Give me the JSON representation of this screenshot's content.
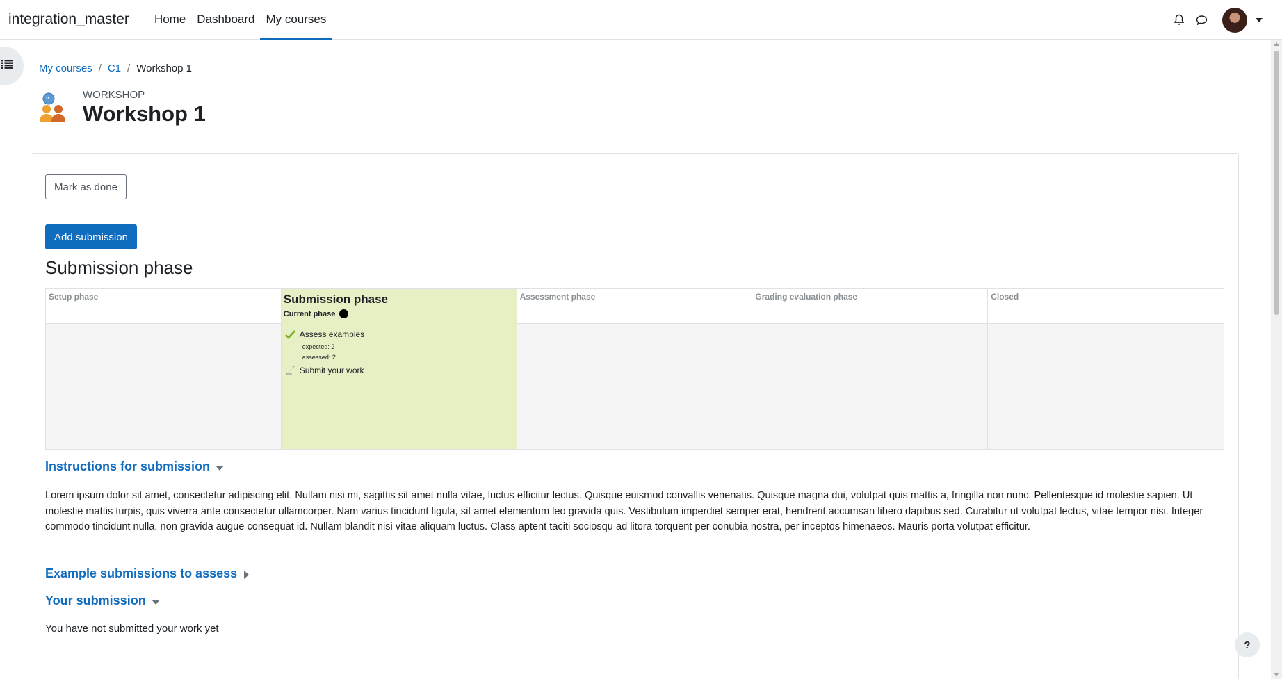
{
  "navbar": {
    "brand": "integration_master",
    "items": [
      {
        "label": "Home"
      },
      {
        "label": "Dashboard"
      },
      {
        "label": "My courses"
      }
    ]
  },
  "breadcrumb": {
    "items": [
      "My courses",
      "C1"
    ],
    "current": "Workshop 1"
  },
  "header": {
    "kind": "WORKSHOP",
    "title": "Workshop 1"
  },
  "actions": {
    "mark_done": "Mark as done",
    "add_submission": "Add submission"
  },
  "phase_heading": "Submission phase",
  "phases": [
    {
      "name": "Setup phase"
    },
    {
      "name": "Submission phase",
      "current_label": "Current phase"
    },
    {
      "name": "Assessment phase"
    },
    {
      "name": "Grading evaluation phase"
    },
    {
      "name": "Closed"
    }
  ],
  "tasks": [
    {
      "label": "Assess examples",
      "status": "done",
      "details": [
        "expected: 2",
        "assessed: 2"
      ]
    },
    {
      "label": "Submit your work",
      "status": "todo"
    }
  ],
  "sections": {
    "instructions": {
      "title": "Instructions for submission",
      "text": "Lorem ipsum dolor sit amet, consectetur adipiscing elit. Nullam nisi mi, sagittis sit amet nulla vitae, luctus efficitur lectus. Quisque euismod convallis venenatis. Quisque magna dui, volutpat quis mattis a, fringilla non nunc. Pellentesque id molestie sapien. Ut molestie mattis turpis, quis viverra ante consectetur ullamcorper. Nam varius tincidunt ligula, sit amet elementum leo gravida quis. Vestibulum imperdiet semper erat, hendrerit accumsan libero dapibus sed. Curabitur ut volutpat lectus, vitae tempor nisi. Integer commodo tincidunt nulla, non gravida augue consequat id. Nullam blandit nisi vitae aliquam luctus. Class aptent taciti sociosqu ad litora torquent per conubia nostra, per inceptos himenaeos. Mauris porta volutpat efficitur."
    },
    "examples": {
      "title": "Example submissions to assess"
    },
    "your_submission": {
      "title": "Your submission",
      "text": "You have not submitted your work yet"
    }
  },
  "help_label": "?",
  "colors": {
    "accent": "#0f6cbf",
    "current_phase_bg": "#e7efc4",
    "done_check": "#7fae2a"
  }
}
